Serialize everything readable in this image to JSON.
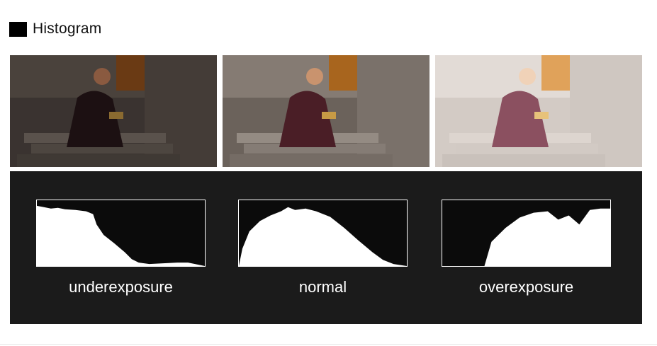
{
  "heading": {
    "title": "Histogram"
  },
  "histograms": [
    {
      "label": "underexposure"
    },
    {
      "label": "normal"
    },
    {
      "label": "overexposure"
    }
  ],
  "colors": {
    "panel": "#1b1b1b",
    "histogram": "#ffffff"
  }
}
